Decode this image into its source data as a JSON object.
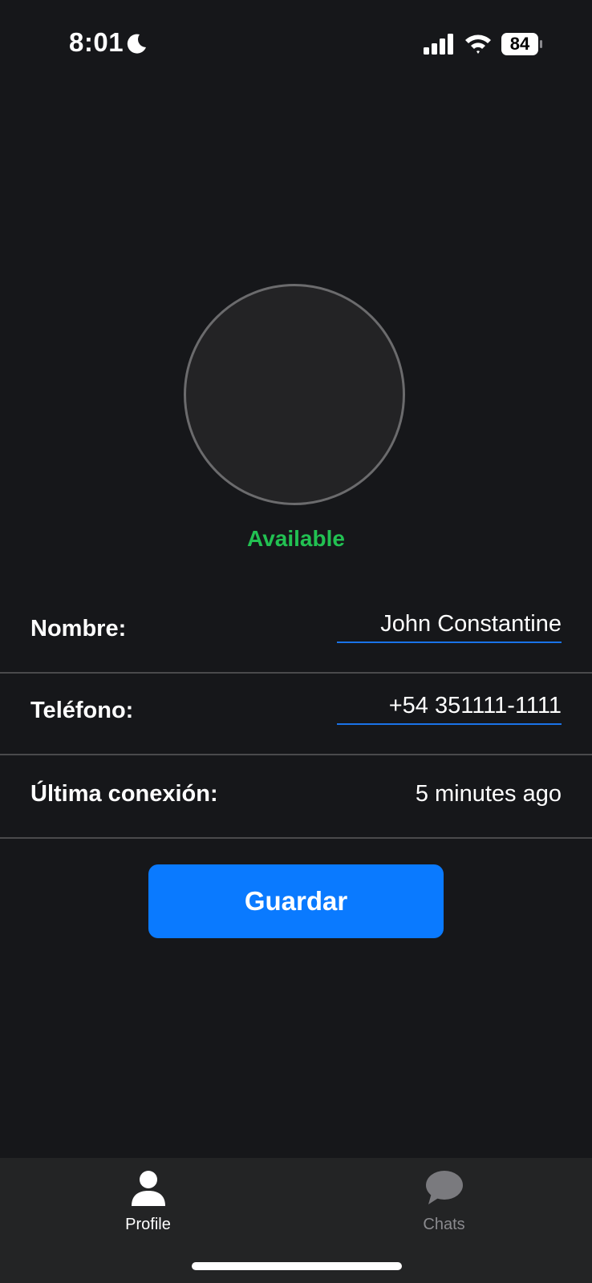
{
  "status_bar": {
    "time": "8:01",
    "battery_level": "84",
    "icons": [
      "moon-icon",
      "signal-icon",
      "wifi-icon",
      "battery-icon"
    ]
  },
  "profile": {
    "status": "Available",
    "status_color": "#22c152"
  },
  "form": {
    "name_label": "Nombre:",
    "name_value": "John Constantine",
    "phone_label": "Teléfono:",
    "phone_value": "+54 351111-1111",
    "last_seen_label": "Última conexión:",
    "last_seen_value": "5 minutes ago"
  },
  "save_button": {
    "label": "Guardar",
    "color": "#0a7aff"
  },
  "tab_bar": {
    "tabs": [
      {
        "label": "Profile",
        "icon": "person-icon",
        "active": true
      },
      {
        "label": "Chats",
        "icon": "chat-bubble-icon",
        "active": false
      }
    ]
  }
}
